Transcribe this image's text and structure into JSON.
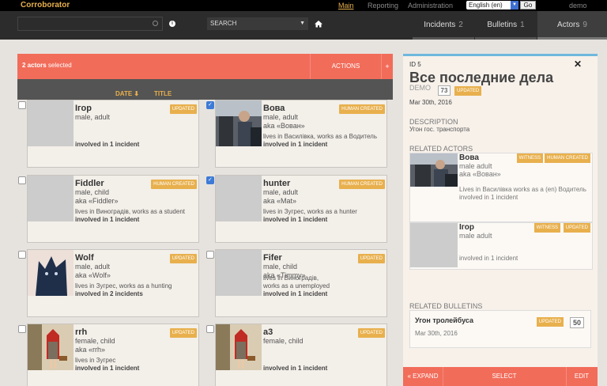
{
  "app": {
    "brand": "Corroborator"
  },
  "topnav": {
    "main": "Main",
    "reporting": "Reporting",
    "administration": "Administration",
    "language": "English (en)",
    "go": "Go",
    "user": "demo"
  },
  "search": {
    "placeholder": "",
    "select_label": "SEARCH"
  },
  "tabs": [
    {
      "label": "Incidents",
      "count": "2"
    },
    {
      "label": "Bulletins",
      "count": "1"
    },
    {
      "label": "Actors",
      "count": "9"
    }
  ],
  "selection": {
    "count": "2 actors",
    "suffix": "selected",
    "actions": "ACTIONS",
    "plus": "+"
  },
  "sort": {
    "date": "DATE",
    "date_arrow": "⬇",
    "title": "TITLE"
  },
  "actors": [
    {
      "name": "Ігор",
      "sub1": "male, adult",
      "sub2": "",
      "lives": "",
      "involved": "involved in 1 incident",
      "badge": "UPDATED",
      "checked": false,
      "thumb": "none"
    },
    {
      "name": "Вова",
      "sub1": "male, adult",
      "sub2": "aka «Вован»",
      "lives": "lives in Василівка, works as a Водитель",
      "involved": "involved in 1 incident",
      "badge": "HUMAN CREATED",
      "checked": true,
      "thumb": "bus"
    },
    {
      "name": "Fiddler",
      "sub1": "male, child",
      "sub2": "aka «Fiddler»",
      "lives": "lives in Виноградів, works as a student",
      "involved": "involved in 1 incident",
      "badge": "HUMAN CREATED",
      "checked": false,
      "thumb": "none"
    },
    {
      "name": "hunter",
      "sub1": "male, adult",
      "sub2": "aka «Mat»",
      "lives": "lives in Зугрес, works as a hunter",
      "involved": "involved in 1 incident",
      "badge": "HUMAN CREATED",
      "checked": true,
      "thumb": "none"
    },
    {
      "name": "Wolf",
      "sub1": "male, adult",
      "sub2": "aka «Wolf»",
      "lives": "lives in Зугрес, works as a hunting",
      "involved": "involved in 2 incidents",
      "badge": "UPDATED",
      "checked": false,
      "thumb": "wolf"
    },
    {
      "name": "Fifer",
      "sub1": "male, child",
      "sub2": "aka «Timmy»",
      "lives": "lives in Виноградів,",
      "lives2": "works as a unemployed",
      "involved": "involved in 1 incident",
      "badge": "UPDATED",
      "checked": false,
      "thumb": "none"
    },
    {
      "name": "rrh",
      "sub1": "female, child",
      "sub2": "aka «rrh»",
      "lives": "lives in Зугрес",
      "involved": "involved in 1 incident",
      "badge": "UPDATED",
      "checked": false,
      "thumb": "girl"
    },
    {
      "name": "a3",
      "sub1": "female, child",
      "sub2": "",
      "lives": "",
      "involved": "involved in 1 incident",
      "badge": "UPDATED",
      "checked": false,
      "thumb": "girl"
    }
  ],
  "detail": {
    "close": "✕",
    "id": "ID 5",
    "title": "Все последние дела",
    "demo": "DEMO",
    "score": "73",
    "updated": "UPDATED",
    "date": "Mar 30th, 2016",
    "description_head": "DESCRIPTION",
    "description": "Угон гос. транспорта",
    "related_actors_head": "RELATED ACTORS",
    "related_actors": [
      {
        "name": "Вова",
        "sub1": "male adult",
        "sub2": "aka «Вован»",
        "lives": "Lives in Василівка works as a (en) Водитель",
        "involved": "involved in 1 incident",
        "badge1": "WITNESS",
        "badge2": "HUMAN CREATED"
      },
      {
        "name": "Ігор",
        "sub1": "male adult",
        "sub2": "",
        "lives": "",
        "involved": "involved in 1 incident",
        "badge1": "WITNESS",
        "badge2": "UPDATED"
      }
    ],
    "related_bulletins_head": "RELATED BULLETINS",
    "bulletin": {
      "title": "Угон тролейбуса",
      "date": "Mar 30th, 2016",
      "badge": "UPDATED",
      "score": "50"
    },
    "footer": {
      "expand": "« EXPAND",
      "select": "SELECT",
      "edit": "EDIT"
    }
  },
  "colors": {
    "accent": "#f26c5a",
    "badge": "#e8b04d",
    "topbar": "#000000",
    "navbar": "#2c2c2c",
    "sortbar": "#545454",
    "detail_border": "#6fb8dc",
    "checkbox": "#3d7bd6"
  }
}
